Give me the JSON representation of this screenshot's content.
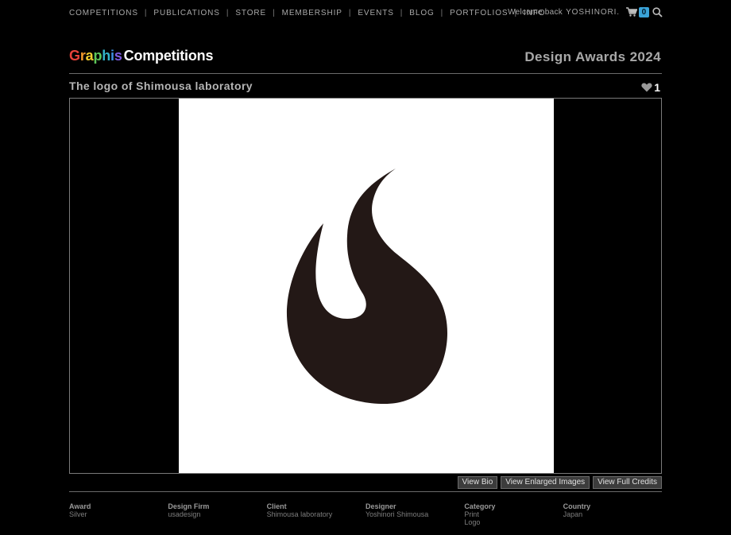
{
  "nav": {
    "items": [
      "COMPETITIONS",
      "PUBLICATIONS",
      "STORE",
      "MEMBERSHIP",
      "EVENTS",
      "BLOG",
      "PORTFOLIOS",
      "INFO"
    ],
    "separator": "|"
  },
  "account": {
    "welcome": "Welcome back",
    "username": "YOSHINORI.",
    "cart_count": "0"
  },
  "header": {
    "brand_letters": [
      "G",
      "r",
      "a",
      "p",
      "h",
      "i",
      "s"
    ],
    "brand_colors": [
      "#e8423a",
      "#f39a2b",
      "#f3cf2f",
      "#5dc65a",
      "#32b3c9",
      "#3d8fe0",
      "#7c5be0"
    ],
    "brand_suffix": "Competitions",
    "edition": "Design Awards 2024"
  },
  "entry": {
    "title": "The logo of Shimousa laboratory",
    "likes": "1"
  },
  "actions": {
    "bio": "View Bio",
    "enlarged": "View Enlarged Images",
    "credits": "View Full Credits"
  },
  "credits": [
    {
      "label": "Award",
      "values": [
        "Silver"
      ]
    },
    {
      "label": "Design Firm",
      "values": [
        "usadesign"
      ]
    },
    {
      "label": "Client",
      "values": [
        "Shimousa laboratory"
      ]
    },
    {
      "label": "Designer",
      "values": [
        "Yoshinori Shimousa"
      ]
    },
    {
      "label": "Category",
      "values": [
        "Print",
        "Logo"
      ]
    },
    {
      "label": "Country",
      "values": [
        "Japan"
      ]
    }
  ],
  "colors": {
    "background": "#000000",
    "logo_fill": "#231816",
    "cart_badge": "#3aa3d8"
  }
}
